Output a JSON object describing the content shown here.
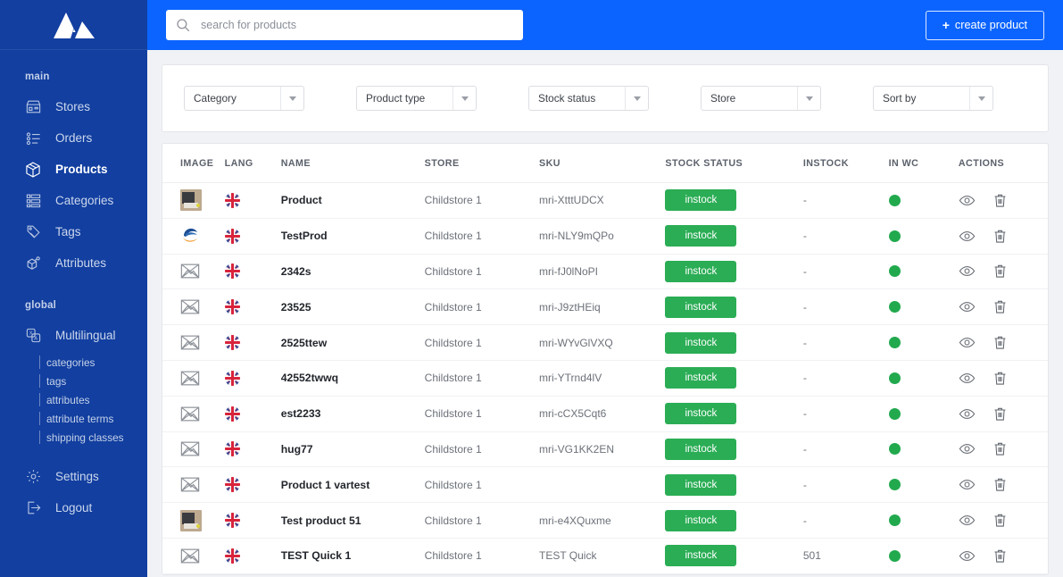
{
  "brand": {
    "logo_name": "app-logo"
  },
  "colors": {
    "sidebar_bg": "#123fa0",
    "topbar_bg": "#0b64ff",
    "accent_green": "#2bad55",
    "page_bg": "#f1f2f5"
  },
  "sidebar": {
    "sections": [
      {
        "label": "main",
        "items": [
          {
            "label": "Stores",
            "icon": "store-icon",
            "active": false
          },
          {
            "label": "Orders",
            "icon": "orders-list-icon",
            "active": false
          },
          {
            "label": "Products",
            "icon": "box-package-icon",
            "active": true
          },
          {
            "label": "Categories",
            "icon": "categories-grid-icon",
            "active": false
          },
          {
            "label": "Tags",
            "icon": "tag-icon",
            "active": false
          },
          {
            "label": "Attributes",
            "icon": "attributes-icon",
            "active": false
          }
        ]
      },
      {
        "label": "global",
        "items": [
          {
            "label": "Multilingual",
            "icon": "multilingual-icon",
            "active": false
          }
        ],
        "sub_items": [
          {
            "label": "categories"
          },
          {
            "label": "tags"
          },
          {
            "label": "attributes"
          },
          {
            "label": "attribute terms"
          },
          {
            "label": "shipping classes"
          }
        ]
      }
    ],
    "footer_items": [
      {
        "label": "Settings",
        "icon": "gear-icon"
      },
      {
        "label": "Logout",
        "icon": "logout-icon"
      }
    ]
  },
  "topbar": {
    "search": {
      "placeholder": "search for products",
      "value": "",
      "icon": "search-icon"
    },
    "create_button": {
      "plus": "+",
      "label": "create product"
    }
  },
  "filters": [
    {
      "label": "Category",
      "name": "category-select"
    },
    {
      "label": "Product type",
      "name": "product-type-select"
    },
    {
      "label": "Stock status",
      "name": "stock-status-select"
    },
    {
      "label": "Store",
      "name": "store-select"
    },
    {
      "label": "Sort by",
      "name": "sort-by-select"
    }
  ],
  "table": {
    "columns": [
      "IMAGE",
      "LANG",
      "NAME",
      "STORE",
      "SKU",
      "STOCK STATUS",
      "INSTOCK",
      "IN WC",
      "ACTIONS"
    ],
    "rows": [
      {
        "image": "photo-thumbnail",
        "lang": "uk-flag-icon",
        "name": "Product",
        "store": "Childstore 1",
        "sku": "mri-XtttUDCX",
        "stock_status": "instock",
        "instock": "-",
        "in_wc": "green-dot"
      },
      {
        "image": "logo-thumbnail",
        "lang": "uk-flag-icon",
        "name": "TestProd",
        "store": "Childstore 1",
        "sku": "mri-NLY9mQPo",
        "stock_status": "instock",
        "instock": "-",
        "in_wc": "green-dot"
      },
      {
        "image": "image-placeholder",
        "lang": "uk-flag-icon",
        "name": "2342s",
        "store": "Childstore 1",
        "sku": "mri-fJ0lNoPI",
        "stock_status": "instock",
        "instock": "-",
        "in_wc": "green-dot"
      },
      {
        "image": "image-placeholder",
        "lang": "uk-flag-icon",
        "name": "23525",
        "store": "Childstore 1",
        "sku": "mri-J9ztHEiq",
        "stock_status": "instock",
        "instock": "-",
        "in_wc": "green-dot"
      },
      {
        "image": "image-placeholder",
        "lang": "uk-flag-icon",
        "name": "2525ttew",
        "store": "Childstore 1",
        "sku": "mri-WYvGlVXQ",
        "stock_status": "instock",
        "instock": "-",
        "in_wc": "green-dot"
      },
      {
        "image": "image-placeholder",
        "lang": "uk-flag-icon",
        "name": "42552twwq",
        "store": "Childstore 1",
        "sku": "mri-YTrnd4lV",
        "stock_status": "instock",
        "instock": "-",
        "in_wc": "green-dot"
      },
      {
        "image": "image-placeholder",
        "lang": "uk-flag-icon",
        "name": "est2233",
        "store": "Childstore 1",
        "sku": "mri-cCX5Cqt6",
        "stock_status": "instock",
        "instock": "-",
        "in_wc": "green-dot"
      },
      {
        "image": "image-placeholder",
        "lang": "uk-flag-icon",
        "name": "hug77",
        "store": "Childstore 1",
        "sku": "mri-VG1KK2EN",
        "stock_status": "instock",
        "instock": "-",
        "in_wc": "green-dot"
      },
      {
        "image": "image-placeholder",
        "lang": "uk-flag-icon",
        "name": "Product 1 vartest",
        "store": "Childstore 1",
        "sku": "",
        "stock_status": "instock",
        "instock": "-",
        "in_wc": "green-dot"
      },
      {
        "image": "photo-thumbnail",
        "lang": "uk-flag-icon",
        "name": "Test product 51",
        "store": "Childstore 1",
        "sku": "mri-e4XQuxme",
        "stock_status": "instock",
        "instock": "-",
        "in_wc": "green-dot"
      },
      {
        "image": "image-placeholder",
        "lang": "uk-flag-icon",
        "name": "TEST Quick 1",
        "store": "Childstore 1",
        "sku": "TEST Quick",
        "stock_status": "instock",
        "instock": "501",
        "in_wc": "green-dot"
      }
    ],
    "row_actions": [
      {
        "name": "view-icon",
        "title": "view"
      },
      {
        "name": "delete-icon",
        "title": "delete"
      }
    ]
  }
}
